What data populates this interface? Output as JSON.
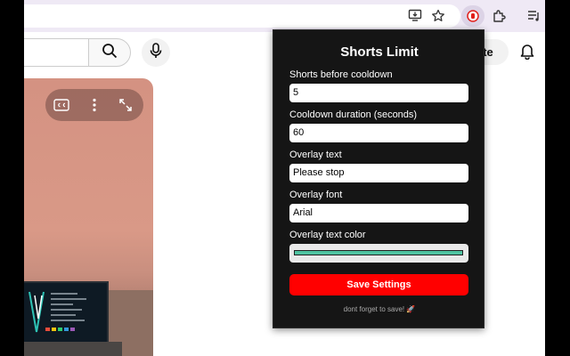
{
  "youtube": {
    "create_label": "ate"
  },
  "popup": {
    "title": "Shorts Limit",
    "fields": [
      {
        "label": "Shorts before cooldown",
        "value": "5"
      },
      {
        "label": "Cooldown duration (seconds)",
        "value": "60"
      },
      {
        "label": "Overlay text",
        "value": "Please stop"
      },
      {
        "label": "Overlay font",
        "value": "Arial"
      }
    ],
    "color_label": "Overlay text color",
    "color_value": "#4fc3a1",
    "save_label": "Save Settings",
    "footer": "dont forget to save! 🚀",
    "accent_color": "#ff0000"
  }
}
